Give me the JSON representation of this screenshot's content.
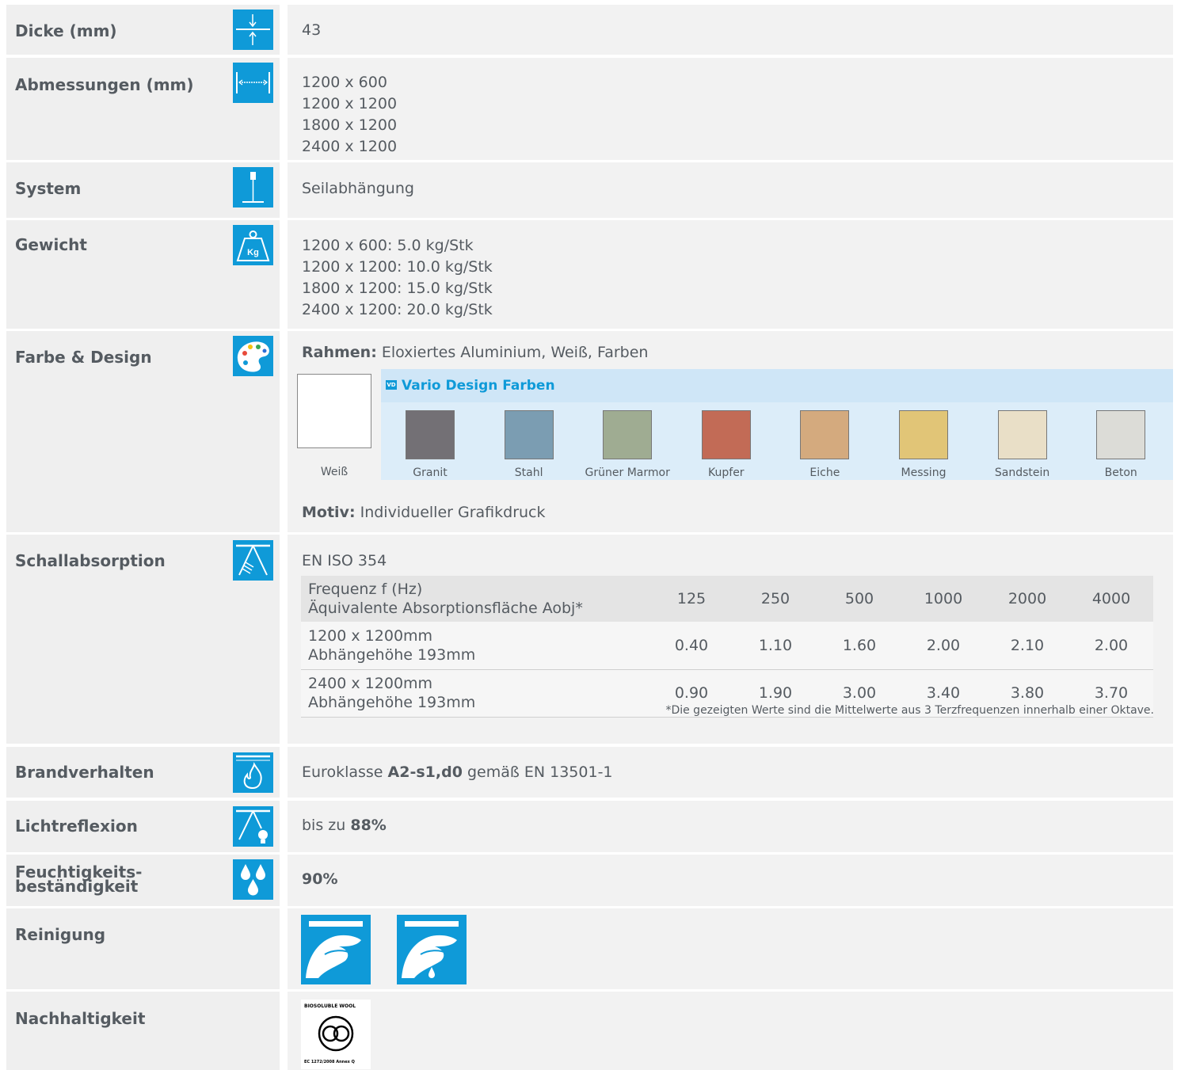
{
  "rows": {
    "dicke": {
      "label": "Dicke (mm)",
      "value": "43"
    },
    "abmessungen": {
      "label": "Abmessungen (mm)",
      "value": "1200 x 600\n1200 x 1200\n1800 x 1200\n2400 x 1200"
    },
    "system": {
      "label": "System",
      "value": "Seilabhängung"
    },
    "gewicht": {
      "label": "Gewicht",
      "value": "1200 x 600: 5.0 kg/Stk\n1200 x 1200: 10.0 kg/Stk\n1800 x 1200: 15.0 kg/Stk\n2400 x 1200: 20.0 kg/Stk",
      "icon_text": "Kg"
    },
    "farbe": {
      "label": "Farbe & Design",
      "rahmen_label": "Rahmen:",
      "rahmen_value": " Eloxiertes Aluminium, Weiß, Farben",
      "white_label": "Weiß",
      "vd_badge": "VD",
      "vd_title": "Vario Design Farben",
      "colors": [
        {
          "name": "Granit",
          "hex": "#737075"
        },
        {
          "name": "Stahl",
          "hex": "#7b9db2"
        },
        {
          "name": "Grüner Marmor",
          "hex": "#9fac92"
        },
        {
          "name": "Kupfer",
          "hex": "#c26b56"
        },
        {
          "name": "Eiche",
          "hex": "#d4aa7e"
        },
        {
          "name": "Messing",
          "hex": "#e1c577"
        },
        {
          "name": "Sandstein",
          "hex": "#e9dfc7"
        },
        {
          "name": "Beton",
          "hex": "#dcdcd7"
        }
      ],
      "motiv_label": "Motiv:",
      "motiv_value": " Individueller Grafikdruck"
    },
    "schall": {
      "label": "Schallabsorption",
      "standard": "EN ISO 354",
      "header_line1": "Frequenz f (Hz)",
      "header_line2": "Äquivalente Absorptionsfläche Aobj*",
      "frequencies": [
        "125",
        "250",
        "500",
        "1000",
        "2000",
        "4000"
      ],
      "rows": [
        {
          "line1": "1200 x 1200mm",
          "line2": "Abhängehöhe 193mm",
          "values": [
            "0.40",
            "1.10",
            "1.60",
            "2.00",
            "2.10",
            "2.00"
          ]
        },
        {
          "line1": "2400 x 1200mm",
          "line2": "Abhängehöhe 193mm",
          "values": [
            "0.90",
            "1.90",
            "3.00",
            "3.40",
            "3.80",
            "3.70"
          ]
        }
      ],
      "note": "*Die gezeigten Werte sind die Mittelwerte aus 3 Terzfrequenzen innerhalb einer Oktave."
    },
    "brand": {
      "label": "Brandverhalten",
      "prefix": "Euroklasse ",
      "klasse": "A2-s1,d0",
      "suffix": " gemäß EN 13501-1"
    },
    "licht": {
      "label": "Lichtreflexion",
      "prefix": "bis zu ",
      "value": "88%"
    },
    "feucht": {
      "label_line1": "Feuchtigkeits-",
      "label_line2": "beständigkeit",
      "value": "90%"
    },
    "reinigung": {
      "label": "Reinigung"
    },
    "nachhaltigkeit": {
      "label": "Nachhaltigkeit",
      "eco_top": "BIOSOLUBLE WOOL",
      "eco_bottom": "EC 1272/2008 Annex Q"
    }
  },
  "colors": {
    "accent": "#0f9ad8",
    "label_bg": "#efefef",
    "value_bg": "#f2f2f2",
    "text": "#555b61"
  },
  "icons": [
    "thickness-icon",
    "dimensions-icon",
    "suspension-icon",
    "weight-icon",
    "palette-icon",
    "sound-absorption-icon",
    "fire-icon",
    "light-reflection-icon",
    "humidity-icon",
    "dry-cleaning-icon",
    "wet-cleaning-icon",
    "biosoluble-wool-logo"
  ]
}
